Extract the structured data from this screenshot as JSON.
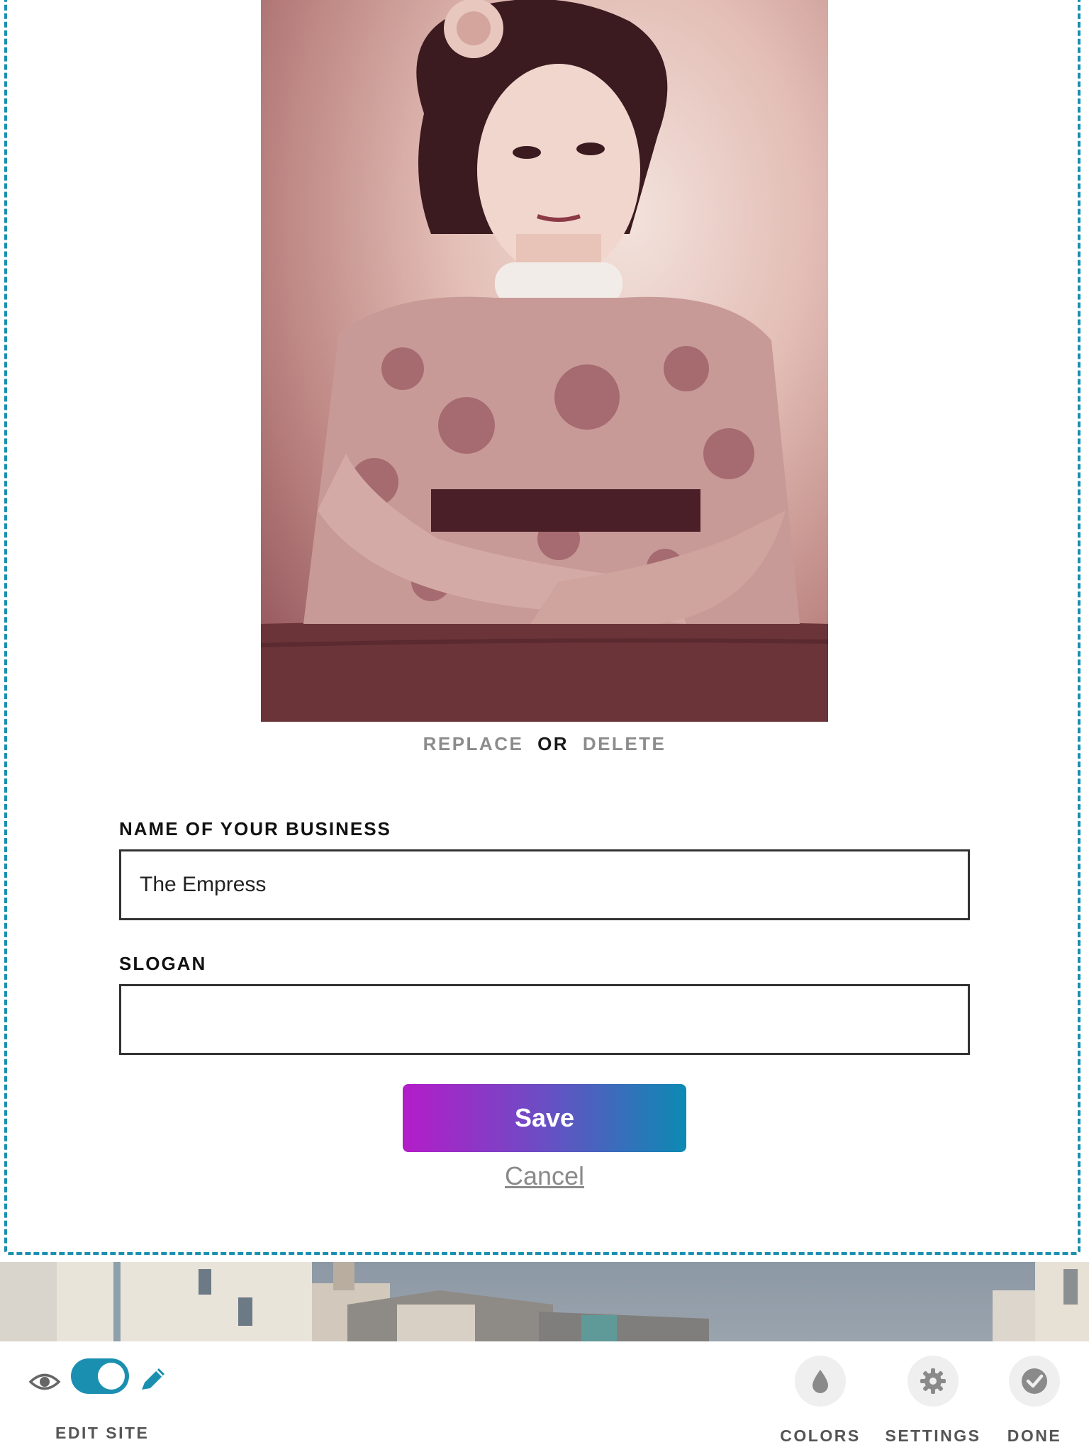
{
  "logo_editor": {
    "photo_alt": "Tattooed woman portrait",
    "replace_label": "REPLACE",
    "or_label": "OR",
    "delete_label": "DELETE",
    "business_name_label": "NAME OF YOUR BUSINESS",
    "business_name_value": "The Empress",
    "slogan_label": "SLOGAN",
    "slogan_value": "",
    "save_label": "Save",
    "cancel_label": "Cancel"
  },
  "toolbar": {
    "edit_site_label": "EDIT SITE",
    "edit_toggle_on": true,
    "colors_label": "COLORS",
    "settings_label": "SETTINGS",
    "done_label": "DONE",
    "icons": [
      "eye-icon",
      "pencil-icon",
      "droplet-icon",
      "gear-icon",
      "checkmark-icon"
    ]
  },
  "colors": {
    "accent": "#1a8fb0",
    "save_gradient_start": "#b41cc8",
    "save_gradient_end": "#0c8ab3"
  }
}
